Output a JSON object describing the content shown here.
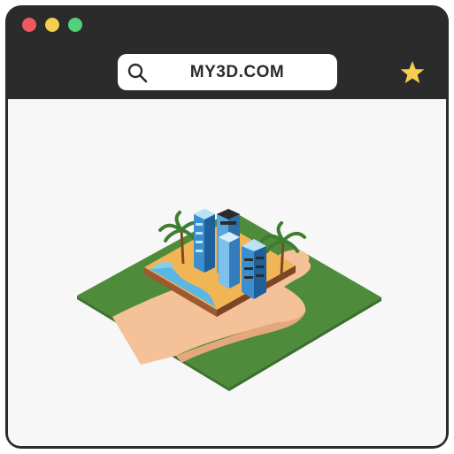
{
  "window": {
    "controls": [
      "close",
      "minimize",
      "maximize"
    ],
    "colors": {
      "frame": "#2b2b2b",
      "close": "#f0585f",
      "minimize": "#f4cf4f",
      "maximize": "#52d07a",
      "star": "#f4cf4f"
    }
  },
  "address_bar": {
    "url": "MY3D.COM",
    "icon": "search-icon"
  },
  "bookmark": {
    "icon": "star-icon"
  },
  "content": {
    "illustration": "hand-holding-3d-city-icon",
    "colors": {
      "grass": "#4e8b3a",
      "sand": "#f2b556",
      "water": "#5ab6e3",
      "skin": "#f4c199"
    }
  }
}
